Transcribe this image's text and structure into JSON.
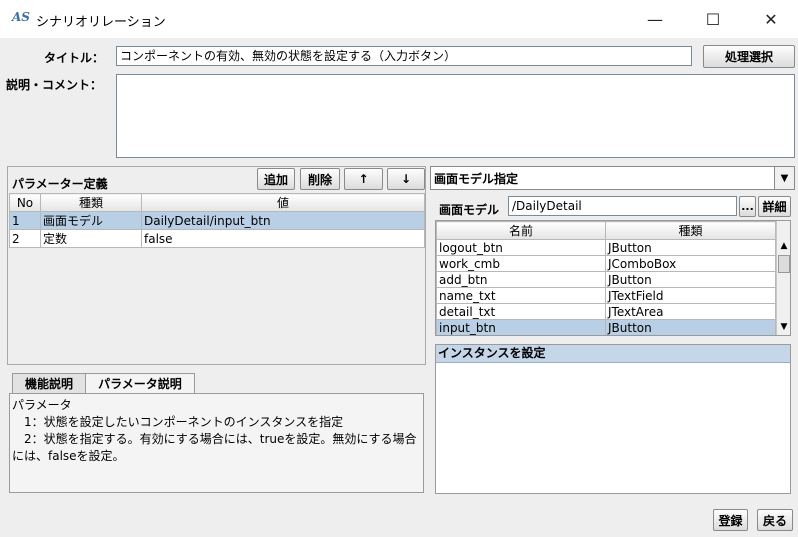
{
  "window": {
    "logo_text": "AS",
    "title": "シナリオリレーション",
    "minimize": "—",
    "maximize": "☐",
    "close": "✕"
  },
  "form": {
    "title_label": "タイトル：",
    "title_value": "コンポーネントの有効、無効の状態を設定する（入力ボタン）",
    "process_button": "処理選択",
    "comment_label": "説明・コメント：",
    "comment_value": ""
  },
  "params": {
    "header": "パラメーター定義",
    "add": "追加",
    "delete": "削除",
    "up": "↑",
    "down": "↓",
    "columns": [
      "No",
      "種類",
      "値"
    ],
    "rows": [
      {
        "no": "1",
        "kind": "画面モデル",
        "value": "DailyDetail/input_btn"
      },
      {
        "no": "2",
        "kind": "定数",
        "value": "false"
      }
    ]
  },
  "tabs": {
    "function": "機能説明",
    "parameter": "パラメータ説明",
    "desc_lines": [
      "パラメータ",
      "　1：状態を設定したいコンポーネントのインスタンスを指定",
      "　2：状態を指定する。有効にする場合には、trueを設定。無効にする場合",
      "には、falseを設定。"
    ]
  },
  "screen_model": {
    "dropdown": "画面モデル指定",
    "label": "画面モデル",
    "value": "/DailyDetail",
    "browse": "...",
    "detail": "詳細",
    "columns": [
      "名前",
      "種類"
    ],
    "rows": [
      {
        "name": "logout_btn",
        "type": "JButton"
      },
      {
        "name": "work_cmb",
        "type": "JComboBox"
      },
      {
        "name": "add_btn",
        "type": "JButton"
      },
      {
        "name": "name_txt",
        "type": "JTextField"
      },
      {
        "name": "detail_txt",
        "type": "JTextArea"
      },
      {
        "name": "input_btn",
        "type": "JButton"
      }
    ],
    "instance_header": "インスタンスを設定"
  },
  "footer": {
    "register": "登録",
    "back": "戻る"
  },
  "colors": {
    "selection": "#b8cfe5",
    "header_blue": "#c5d6e9"
  }
}
